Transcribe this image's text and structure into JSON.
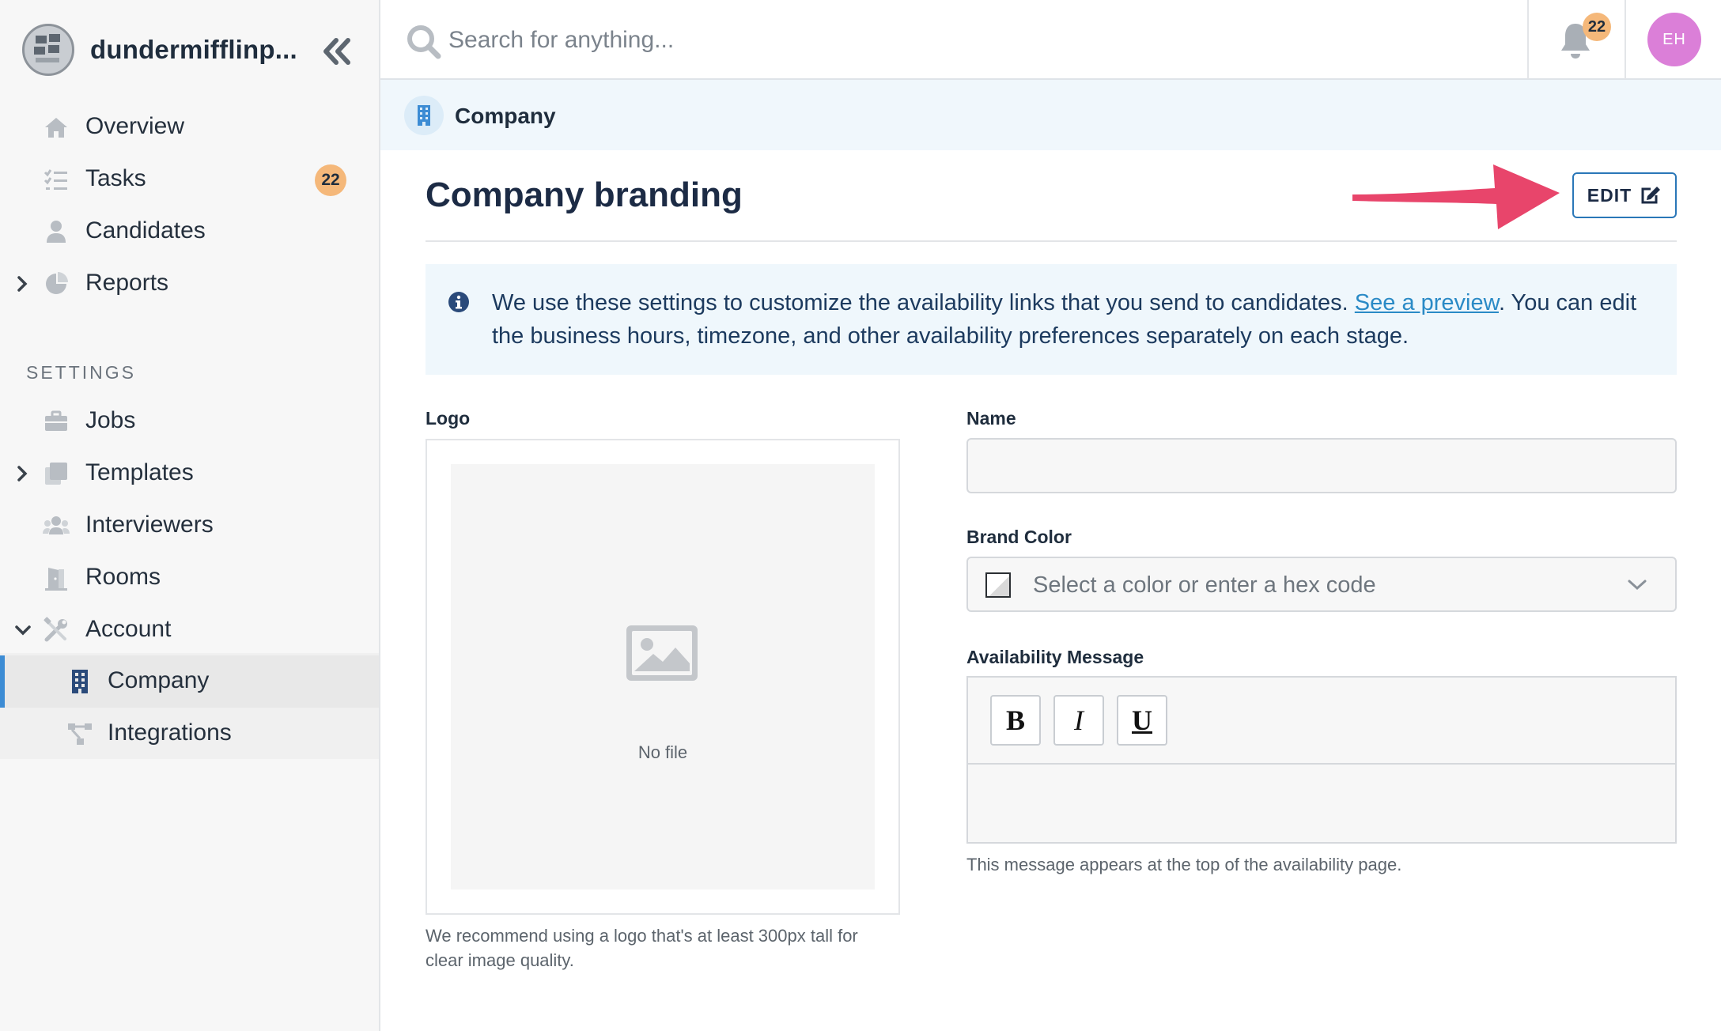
{
  "sidebar": {
    "org_name": "dundermifflinp...",
    "items": [
      {
        "label": "Overview",
        "icon": "home-icon"
      },
      {
        "label": "Tasks",
        "icon": "tasks-icon",
        "badge": "22"
      },
      {
        "label": "Candidates",
        "icon": "user-icon"
      },
      {
        "label": "Reports",
        "icon": "pie-chart-icon"
      }
    ],
    "settings_heading": "SETTINGS",
    "settings_items": [
      {
        "label": "Jobs",
        "icon": "briefcase-icon"
      },
      {
        "label": "Templates",
        "icon": "templates-icon"
      },
      {
        "label": "Interviewers",
        "icon": "users-icon"
      },
      {
        "label": "Rooms",
        "icon": "door-icon"
      },
      {
        "label": "Account",
        "icon": "tools-icon"
      }
    ],
    "account_items": [
      {
        "label": "Company",
        "icon": "building-icon",
        "active": true
      },
      {
        "label": "Integrations",
        "icon": "integrations-icon"
      }
    ]
  },
  "topbar": {
    "search_placeholder": "Search for anything...",
    "notification_count": "22",
    "avatar_initials": "EH"
  },
  "breadcrumb": {
    "label": "Company"
  },
  "main": {
    "title": "Company branding",
    "edit_label": "EDIT",
    "info_text_before": "We use these settings to customize the availability links that you send to candidates. ",
    "info_link": "See a preview",
    "info_text_after": ". You can edit the business hours, timezone, and other availability preferences separately on each stage.",
    "logo_label": "Logo",
    "no_file": "No file",
    "logo_help": "We recommend using a logo that's at least 300px tall for clear image quality.",
    "name_label": "Name",
    "name_value": "",
    "brand_color_label": "Brand Color",
    "brand_color_placeholder": "Select a color or enter a hex code",
    "availability_label": "Availability Message",
    "format_bold": "B",
    "format_italic": "I",
    "format_underline": "U",
    "availability_help": "This message appears at the top of the availability page."
  },
  "colors": {
    "accent": "#2a77b8",
    "badge": "#f5b87a",
    "avatar": "#db7fd8",
    "annotation_arrow": "#e8456b",
    "active_indicator": "#3d8cd4"
  }
}
